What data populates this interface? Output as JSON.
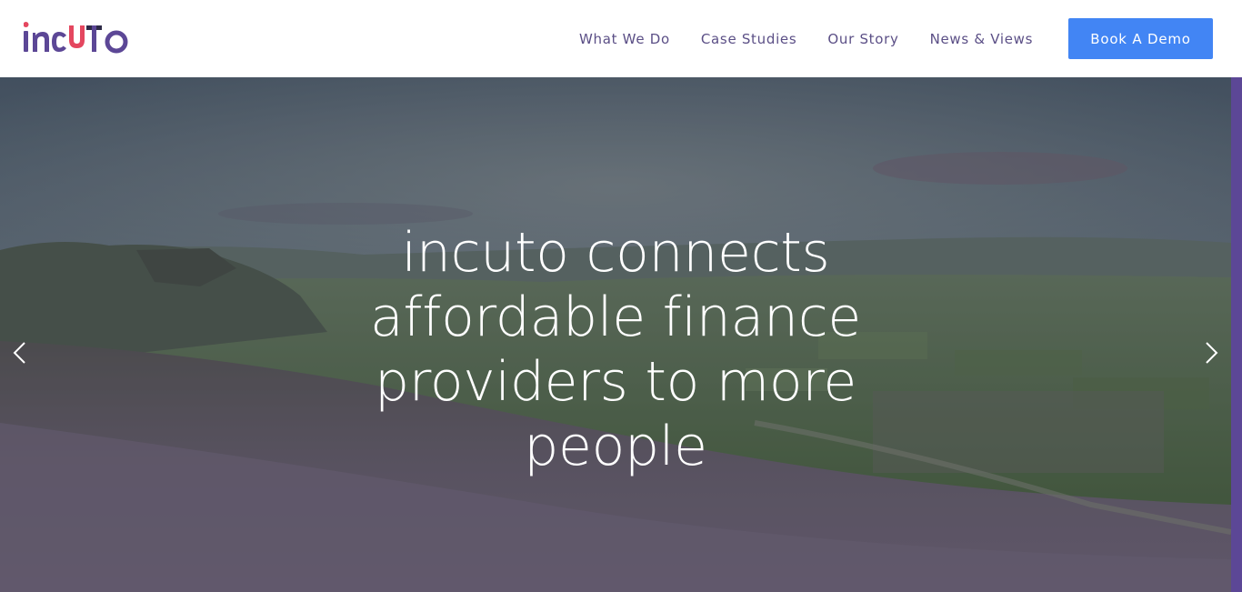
{
  "brand": {
    "name": "incuto",
    "colors": {
      "purple": "#5c4796",
      "red": "#e4475f",
      "nav_text": "#5b4f86",
      "button": "#4285f4"
    }
  },
  "nav": {
    "items": [
      {
        "label": "What We Do"
      },
      {
        "label": "Case Studies"
      },
      {
        "label": "Our Story"
      },
      {
        "label": "News & Views"
      }
    ],
    "cta_label": "Book A Demo"
  },
  "hero": {
    "headline": "incuto connects affordable finance providers to more people",
    "background": "moorland heather landscape with village",
    "prev_icon": "chevron-left-icon",
    "next_icon": "chevron-right-icon"
  }
}
